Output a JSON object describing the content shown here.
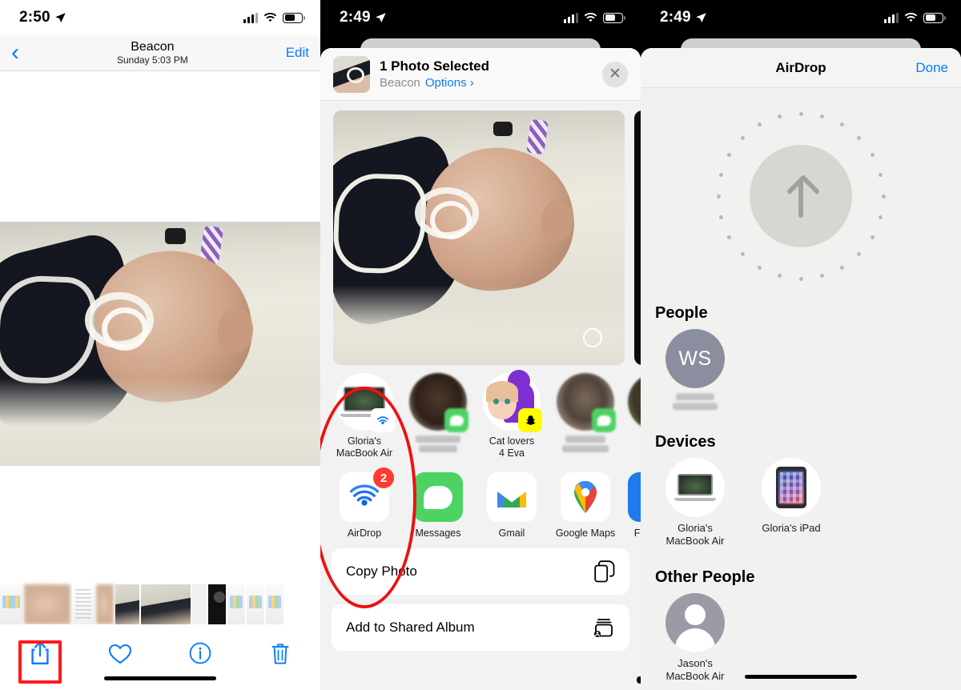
{
  "panel1": {
    "status": {
      "time": "2:50",
      "location_icon": "location-arrow-icon",
      "signal_icon": "cellular-bars-icon",
      "wifi_icon": "wifi-icon",
      "battery_icon": "battery-icon"
    },
    "nav": {
      "back_icon": "chevron-left-icon",
      "title": "Beacon",
      "subtitle": "Sunday  5:03 PM",
      "edit_label": "Edit"
    },
    "toolbar": [
      {
        "name": "share-button",
        "icon": "share-icon",
        "highlighted": true
      },
      {
        "name": "favorite-button",
        "icon": "heart-icon",
        "highlighted": false
      },
      {
        "name": "info-button",
        "icon": "info-circle-icon",
        "highlighted": false
      },
      {
        "name": "delete-button",
        "icon": "trash-icon",
        "highlighted": false
      }
    ],
    "highlight_color": "#ff1a1a"
  },
  "panel2": {
    "status": {
      "time": "2:49"
    },
    "sheet_header": {
      "title": "1 Photo Selected",
      "album": "Beacon",
      "options_label": "Options",
      "options_chevron": "›",
      "close_icon": "close-x-icon"
    },
    "suggestions": [
      {
        "label": "Gloria's\nMacBook Air",
        "label_line1": "Gloria's",
        "label_line2": "MacBook Air",
        "badge": "airdrop-badge"
      },
      {
        "label_line1": "",
        "label_line2": "",
        "badge": "messages-badge",
        "redacted": true
      },
      {
        "label_line1": "Cat lovers",
        "label_line2": "4 Eva",
        "badge": "snapchat-badge"
      },
      {
        "label_line1": "",
        "label_line2": "",
        "badge": "messages-badge",
        "redacted": true
      }
    ],
    "apps": [
      {
        "label": "AirDrop",
        "badge": "2"
      },
      {
        "label": "Messages",
        "badge": ""
      },
      {
        "label": "Gmail",
        "badge": ""
      },
      {
        "label": "Google Maps",
        "badge": ""
      },
      {
        "label": "Fa",
        "badge": ""
      }
    ],
    "actions": [
      {
        "label": "Copy Photo",
        "icon": "copy-icon"
      },
      {
        "label": "Add to Shared Album",
        "icon": "shared-album-icon"
      }
    ],
    "annotation_color": "#ee1111"
  },
  "panel3": {
    "status": {
      "time": "2:49"
    },
    "header": {
      "title": "AirDrop",
      "done_label": "Done"
    },
    "radar": {
      "icon": "arrow-up-icon"
    },
    "sections": [
      {
        "title": "People",
        "items": [
          {
            "name_line1": "",
            "name_line2": "",
            "avatar_kind": "initials",
            "initials": "WS",
            "redacted": true
          }
        ]
      },
      {
        "title": "Devices",
        "items": [
          {
            "name_line1": "Gloria's",
            "name_line2": "MacBook Air",
            "avatar_kind": "macbook"
          },
          {
            "name_line1": "Gloria's iPad",
            "name_line2": "",
            "avatar_kind": "ipad"
          }
        ]
      },
      {
        "title": "Other People",
        "items": [
          {
            "name_line1": "Jason's",
            "name_line2": "MacBook Air",
            "avatar_kind": "person"
          }
        ]
      }
    ]
  }
}
